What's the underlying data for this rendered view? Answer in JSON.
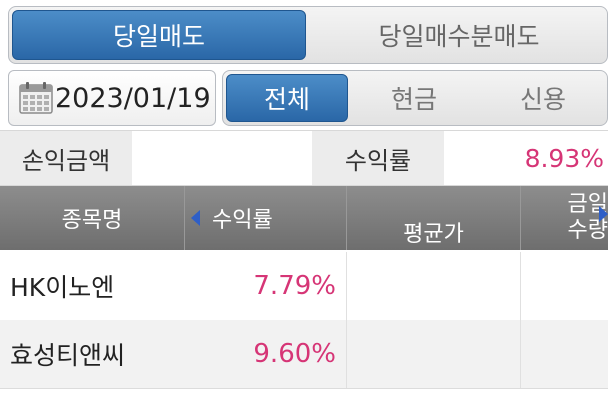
{
  "top_tabs": [
    {
      "label": "당일매도",
      "active": true
    },
    {
      "label": "당일매수분매도",
      "active": false
    }
  ],
  "date": {
    "value": "2023/01/19",
    "icon": "calendar-icon"
  },
  "filter_tabs": [
    {
      "label": "전체",
      "active": true
    },
    {
      "label": "현금",
      "active": false
    },
    {
      "label": "신용",
      "active": false
    }
  ],
  "summary": {
    "profit_amount_label": "손익금액",
    "profit_amount_value": "",
    "return_rate_label": "수익률",
    "return_rate_value": "8.93%"
  },
  "table": {
    "headers": {
      "name": "종목명",
      "return_rate": "수익률",
      "avg_price": "평균가",
      "col4_line1": "금일",
      "col4_line2": "수량"
    },
    "rows": [
      {
        "name": "HK이노엔",
        "return_rate": "7.79%",
        "avg_price": "",
        "col4": ""
      },
      {
        "name": "효성티앤씨",
        "return_rate": "9.60%",
        "avg_price": "",
        "col4": ""
      }
    ]
  },
  "colors": {
    "accent": "#2a67a7",
    "positive": "#d63576",
    "header_bg": "#7d7d7d"
  }
}
